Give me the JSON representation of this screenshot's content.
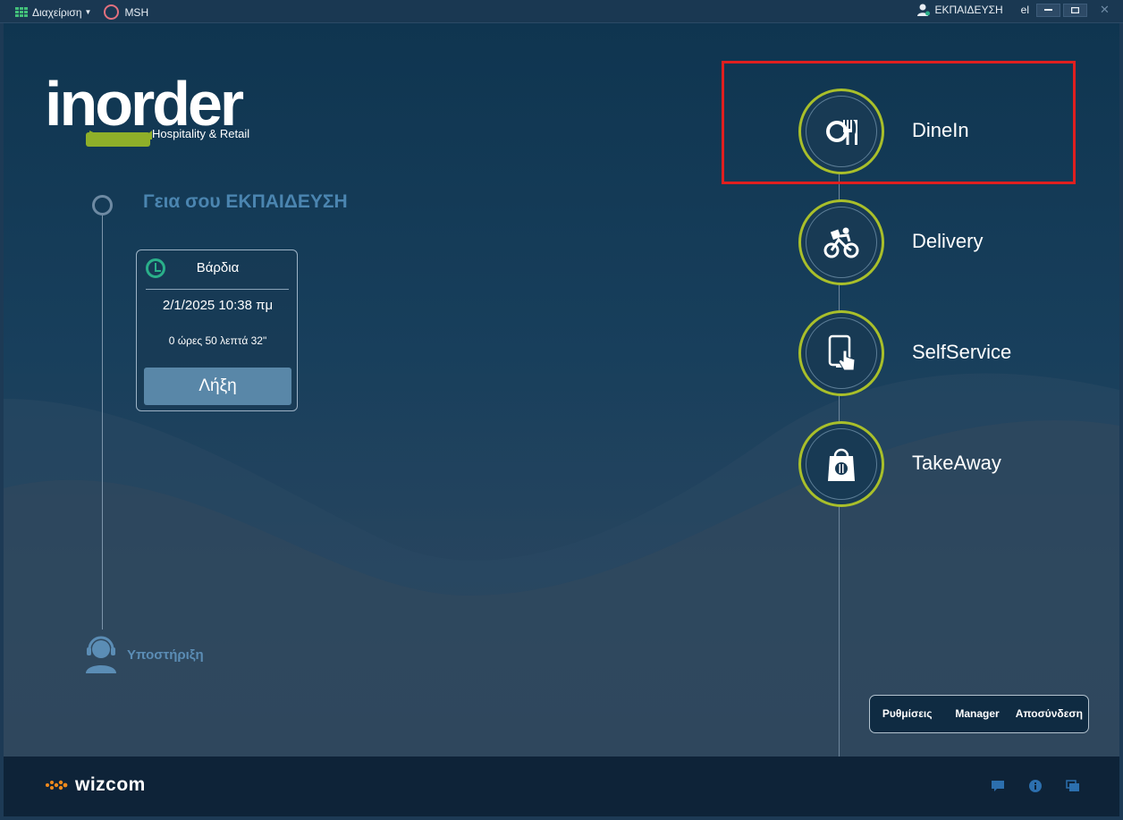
{
  "titlebar": {
    "menu_label": "Διαχείριση",
    "store_label": "MSH",
    "user_label": "ΕΚΠΑΙΔΕΥΣΗ",
    "language": "el"
  },
  "logo": {
    "brand": "inorder",
    "tagline": "Hospitality & Retail"
  },
  "greeting": "Γεια σου ΕΚΠΑΙΔΕΥΣΗ",
  "shift": {
    "title": "Βάρδια",
    "datetime": "2/1/2025 10:38 πμ",
    "duration": "0 ώρες 50 λεπτά 32\"",
    "end_button": "Λήξη"
  },
  "support": {
    "label": "Υποστήριξη"
  },
  "modes": [
    {
      "label": "DineIn",
      "icon": "dine-in-icon"
    },
    {
      "label": "Delivery",
      "icon": "delivery-bike-icon"
    },
    {
      "label": "SelfService",
      "icon": "self-service-tablet-icon"
    },
    {
      "label": "TakeAway",
      "icon": "takeaway-bag-icon"
    }
  ],
  "bottom_menu": {
    "settings": "Ρυθμίσεις",
    "manager": "Manager",
    "logout": "Αποσύνδεση"
  },
  "footer": {
    "brand": "wizcom"
  },
  "colors": {
    "accent_ring": "#a9bf2a",
    "background": "#183f5c",
    "highlight": "#e01f1f",
    "greeting": "#4b85b0"
  }
}
